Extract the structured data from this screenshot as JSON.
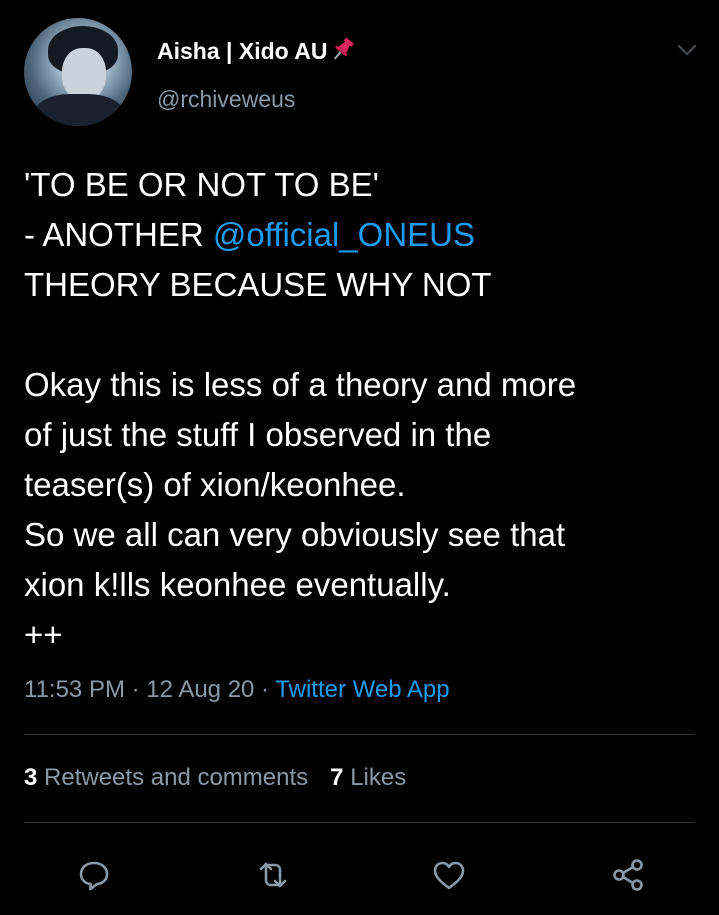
{
  "tweet": {
    "display_name": "Aisha | Xido AU",
    "handle": "@rchiveweus",
    "text_lines": {
      "l1": "'TO BE OR NOT TO BE'",
      "l2_pre": "- ANOTHER ",
      "l2_mention": "@official_ONEUS",
      "l3": "THEORY BECAUSE WHY NOT",
      "l4": "Okay this is less of a theory and more",
      "l5": "of just the stuff I observed in the",
      "l6": "teaser(s) of xion/keonhee.",
      "l7": "So we all can very obviously see that",
      "l8": "xion k!lls keonhee eventually.",
      "l9": "++"
    },
    "time": "11:53 PM",
    "date": "12 Aug 20",
    "separator": " · ",
    "source": "Twitter Web App",
    "retweets_count": "3",
    "retweets_label": "Retweets and comments",
    "likes_count": "7",
    "likes_label": "Likes"
  },
  "icons": {
    "pin": "pushpin-icon",
    "menu": "chevron-down-icon",
    "reply": "reply-icon",
    "retweet": "retweet-icon",
    "like": "heart-icon",
    "share": "share-icon"
  },
  "colors": {
    "background": "#000000",
    "text": "#ffffff",
    "secondary": "#8b98a5",
    "link": "#1d9bf0",
    "pin": "#e0245e"
  }
}
